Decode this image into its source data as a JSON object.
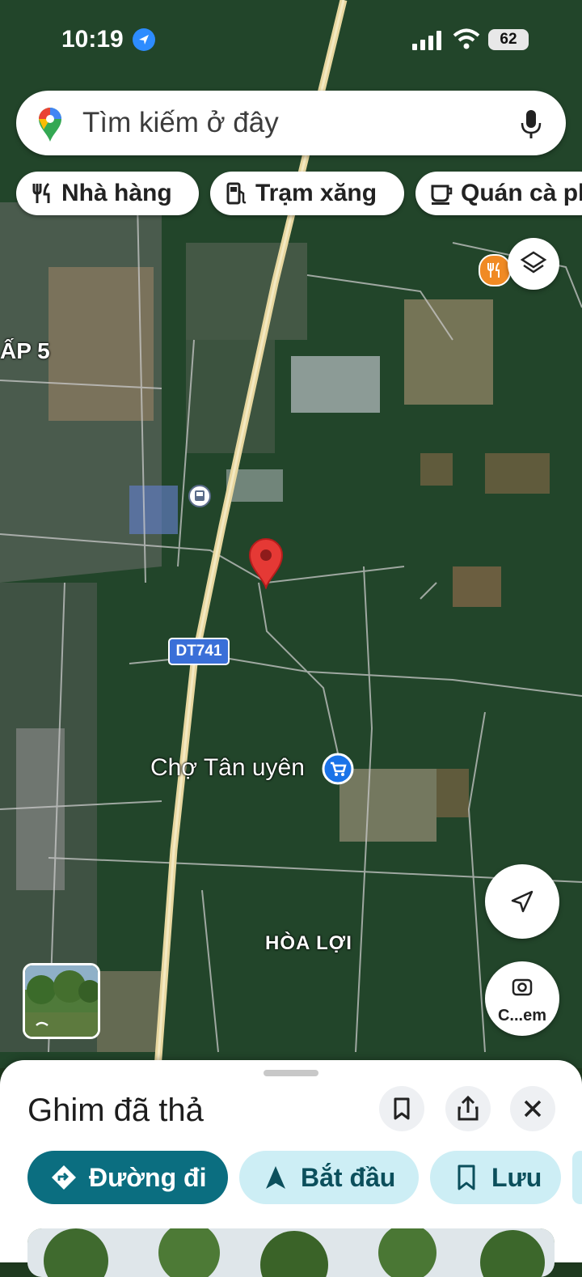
{
  "status_bar": {
    "time": "10:19",
    "battery": "62"
  },
  "search": {
    "placeholder": "Tìm kiếm ở đây"
  },
  "chips": [
    {
      "label": "Nhà hàng",
      "icon": "fork-knife-icon"
    },
    {
      "label": "Trạm xăng",
      "icon": "gas-station-icon"
    },
    {
      "label": "Quán cà phê",
      "icon": "coffee-cup-icon"
    }
  ],
  "map": {
    "labels": {
      "road_badge": "DT741",
      "market": "Chợ Tân uyên",
      "area": "HÒA LỢI",
      "ap": "ẤP 5"
    },
    "camera_button": "C...em",
    "colors": {
      "pin": "#e53935",
      "road": "#e8d7a0",
      "market_pin": "#1a73e8",
      "restaurant_pin": "#f08a24"
    }
  },
  "sheet": {
    "title": "Ghim đã thả",
    "actions": [
      {
        "label": "Đường đi",
        "icon": "directions-icon"
      },
      {
        "label": "Bắt đầu",
        "icon": "navigation-arrow-icon"
      },
      {
        "label": "Lưu",
        "icon": "bookmark-icon"
      }
    ],
    "colors": {
      "primary": "#0b6e80",
      "secondary_bg": "#cdeef5"
    }
  }
}
